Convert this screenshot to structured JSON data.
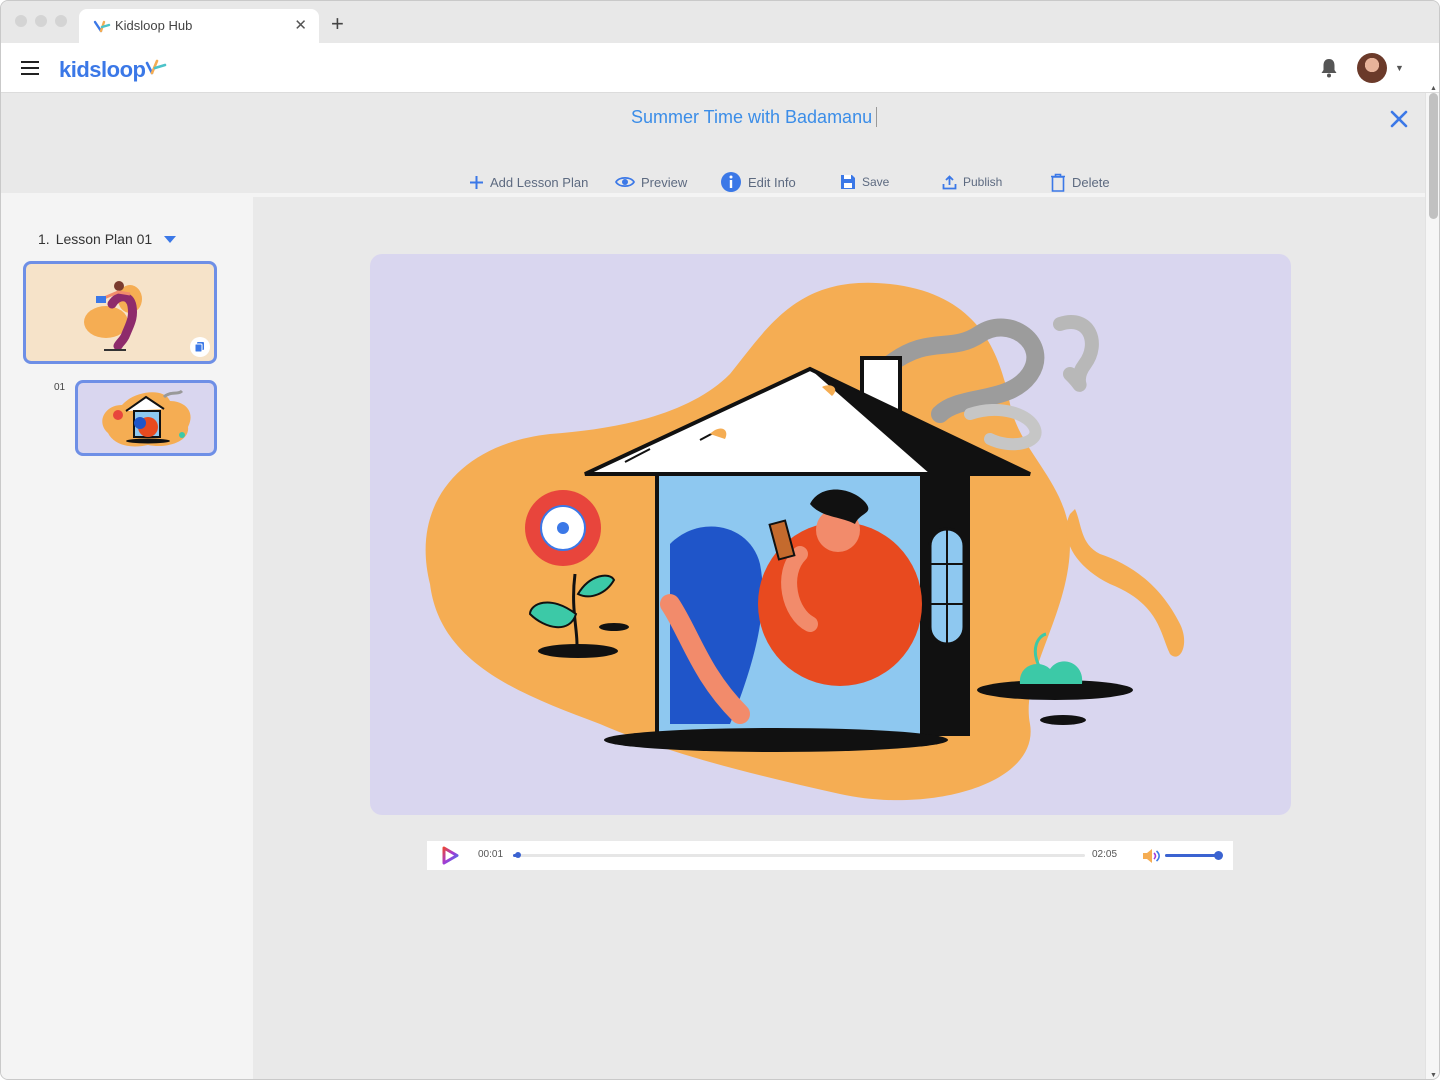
{
  "browser": {
    "tab_title": "Kidsloop Hub",
    "new_tab_symbol": "+",
    "close_tab_symbol": "✕"
  },
  "header": {
    "logo_text": "kidsloop",
    "icons": [
      "menu-icon",
      "bell-icon",
      "avatar",
      "chevron-down-icon"
    ]
  },
  "document": {
    "title": "Summer Time with Badamanu"
  },
  "toolbar": {
    "add_lesson_plan": "Add Lesson Plan",
    "preview": "Preview",
    "edit_info": "Edit Info",
    "save": "Save",
    "publish": "Publish",
    "delete": "Delete"
  },
  "sidebar": {
    "plan_number": "1.",
    "plan_name": "Lesson Plan 01",
    "slides": [
      {
        "label": "",
        "selected": true
      },
      {
        "label": "01",
        "selected": false
      }
    ]
  },
  "player": {
    "current_time": "00:01",
    "total_time": "02:05",
    "progress": 0.008,
    "volume": 0.95
  },
  "colors": {
    "accent": "#3b78e7",
    "title_blue": "#3b8de8",
    "stage_bg": "#d9d6ef",
    "blob_orange": "#f5ad53"
  }
}
